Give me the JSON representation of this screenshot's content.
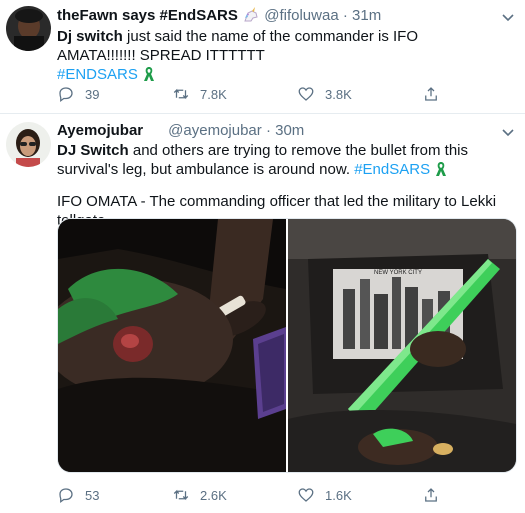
{
  "tweet1": {
    "name": "theFawn says #EndSARS",
    "handle": "@fifoluwaa",
    "dot": "·",
    "time": "31m",
    "body_bold": "Dj switch",
    "body_rest": " just said the name of the commander is IFO AMATA!!!!!!! SPREAD ITTTTTT",
    "hashtag": "#ENDSARS",
    "replies": "39",
    "retweets": "7.8K",
    "likes": "3.8K"
  },
  "tweet2": {
    "name": "Ayemojubar",
    "handle": "@ayemojubar",
    "dot": "·",
    "time": "30m",
    "body_bold": "DJ Switch",
    "body_rest": " and others are trying to remove the bullet from this survival's leg, but ambulance is around now. ",
    "hashtag": "#EndSARS",
    "body_line2": "IFO OMATA - The commanding officer that led the military to Lekki tollgate.",
    "image_right_print": "NEW YORK CITY",
    "replies": "53",
    "retweets": "2.6K",
    "likes": "1.6K"
  },
  "colors": {
    "accent": "#1da1f2",
    "secondary_text": "#5b7083",
    "ribbon_green": "#1e9c4a"
  },
  "icons": [
    "reply-icon",
    "retweet-icon",
    "like-icon",
    "share-icon",
    "chevron-down-icon",
    "unicorn-emoji-icon",
    "green-ribbon-icon"
  ]
}
